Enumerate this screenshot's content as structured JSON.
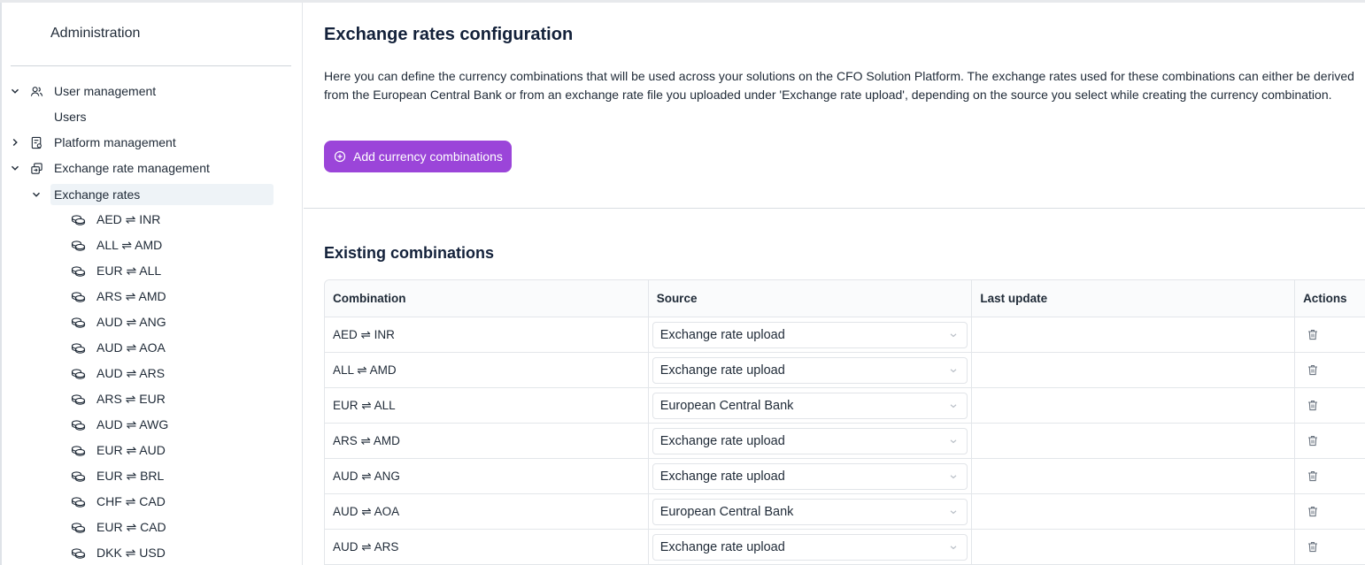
{
  "sidebar": {
    "title": "Administration",
    "sections": [
      {
        "label": "User management",
        "expanded": true,
        "icon": "users-icon"
      },
      {
        "label": "Users"
      },
      {
        "label": "Platform management",
        "expanded": false,
        "icon": "platform-doc-icon"
      },
      {
        "label": "Exchange rate management",
        "expanded": true,
        "icon": "exchange-icon"
      },
      {
        "label": "Exchange rates",
        "expanded": true,
        "active": true
      }
    ],
    "rates": [
      "AED ⇌ INR",
      "ALL ⇌ AMD",
      "EUR ⇌ ALL",
      "ARS ⇌ AMD",
      "AUD ⇌ ANG",
      "AUD ⇌ AOA",
      "AUD ⇌ ARS",
      "ARS ⇌ EUR",
      "AUD ⇌ AWG",
      "EUR ⇌ AUD",
      "EUR ⇌ BRL",
      "CHF ⇌ CAD",
      "EUR ⇌ CAD",
      "DKK ⇌ USD"
    ]
  },
  "main": {
    "title": "Exchange rates configuration",
    "description": "Here you can define the currency combinations that will be used across your solutions on the CFO Solution Platform. The exchange rates used for these combinations can either be derived from the European Central Bank or from an exchange rate file you uploaded under 'Exchange rate upload', depending on the source you select while creating the currency combination.",
    "add_button": "Add currency combinations",
    "section_title": "Existing combinations",
    "table": {
      "headers": [
        "Combination",
        "Source",
        "Last update",
        "Actions"
      ],
      "rows": [
        {
          "combination": "AED ⇌ INR",
          "source": "Exchange rate upload",
          "last_update": ""
        },
        {
          "combination": "ALL ⇌ AMD",
          "source": "Exchange rate upload",
          "last_update": ""
        },
        {
          "combination": "EUR ⇌ ALL",
          "source": "European Central Bank",
          "last_update": ""
        },
        {
          "combination": "ARS ⇌ AMD",
          "source": "Exchange rate upload",
          "last_update": ""
        },
        {
          "combination": "AUD ⇌ ANG",
          "source": "Exchange rate upload",
          "last_update": ""
        },
        {
          "combination": "AUD ⇌ AOA",
          "source": "European Central Bank",
          "last_update": ""
        },
        {
          "combination": "AUD ⇌ ARS",
          "source": "Exchange rate upload",
          "last_update": ""
        }
      ]
    }
  },
  "colors": {
    "accent": "#9b45d9",
    "active_bg": "#eef3f7",
    "text": "#1f2a37"
  }
}
